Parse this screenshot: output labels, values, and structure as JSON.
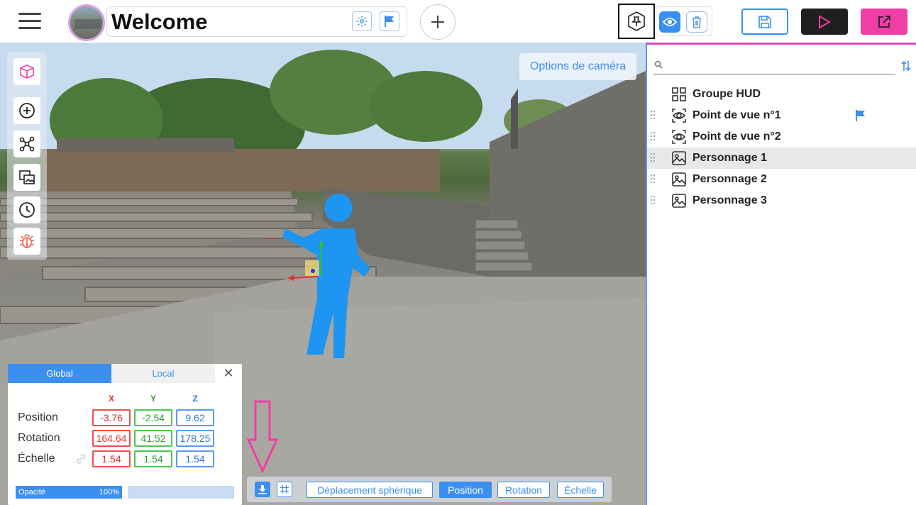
{
  "header": {
    "title": "Welcome"
  },
  "viewport": {
    "camera_options_label": "Options de caméra"
  },
  "transform_panel": {
    "tabs": [
      "Global",
      "Local"
    ],
    "axes": [
      "X",
      "Y",
      "Z"
    ],
    "rows": [
      {
        "label": "Position",
        "x": "-3.76",
        "y": "-2.54",
        "z": "9.62"
      },
      {
        "label": "Rotation",
        "x": "164.64",
        "y": "41.52",
        "z": "178.25"
      },
      {
        "label": "Échelle",
        "x": "1.54",
        "y": "1.54",
        "z": "1.54"
      }
    ],
    "opacity_label": "Opacité",
    "opacity_value": "100%"
  },
  "transform_bar": {
    "modes": [
      "Déplacement sphérique",
      "Position",
      "Rotation",
      "Échelle"
    ],
    "active_mode": "Position"
  },
  "scene_panel": {
    "search_placeholder": "",
    "items": [
      {
        "label": "Groupe HUD",
        "icon": "grid-icon",
        "selected": false,
        "flag": false
      },
      {
        "label": "Point de vue n°1",
        "icon": "viewpoint-icon",
        "selected": false,
        "flag": true
      },
      {
        "label": "Point de vue n°2",
        "icon": "viewpoint-icon",
        "selected": false,
        "flag": false
      },
      {
        "label": "Personnage 1",
        "icon": "image-icon",
        "selected": true,
        "flag": false
      },
      {
        "label": "Personnage 2",
        "icon": "image-icon",
        "selected": false,
        "flag": false
      },
      {
        "label": "Personnage 3",
        "icon": "image-icon",
        "selected": false,
        "flag": false
      }
    ]
  },
  "colors": {
    "accent": "#3b8ff0",
    "export": "#f03ea7",
    "axis_x": "#e03333",
    "axis_y": "#2a9f2a",
    "axis_z": "#2f78d6",
    "annotation_arrow": "#f03ea7"
  }
}
